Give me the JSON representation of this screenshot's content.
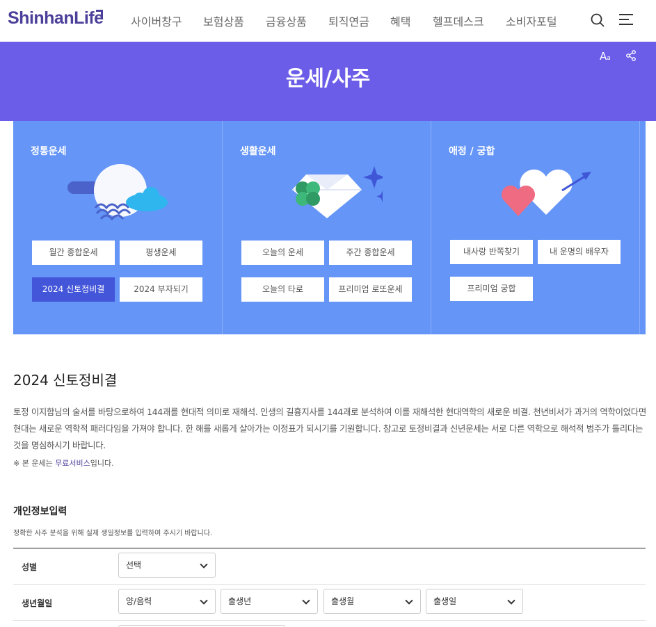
{
  "header": {
    "logo": "ShinhanLife",
    "nav": [
      "사이버창구",
      "보험상품",
      "금융상품",
      "퇴직연금",
      "혜택",
      "헬프데스크",
      "소비자포털"
    ]
  },
  "banner": {
    "title": "운세/사주",
    "font_size_label": "A",
    "font_size_small": "a"
  },
  "categories": [
    {
      "title": "정통운세",
      "items": [
        "월간 종합운세",
        "평생운세",
        "2024 신토정비결",
        "2024 부자되기"
      ]
    },
    {
      "title": "생활운세",
      "items": [
        "오늘의 운세",
        "주간 종합운세",
        "오늘의 타로",
        "프리미엄 로또운세"
      ]
    },
    {
      "title": "애정 / 궁합",
      "items": [
        "내사랑 반쪽찾기",
        "내 운명의 배우자",
        "프리미엄 궁합"
      ]
    }
  ],
  "active_item": "2024 신토정비결",
  "content": {
    "heading": "2024 신토정비결",
    "description": "토정 이지함님의 술서를 바탕으로하여 144괘를 현대적 의미로 재해석. 인생의 길흉지사를 144괘로 분석하여 이를 재해석한 현대역학의 새로운 비결. 천년비서가 과거의 역학이었다면 현대는 새로운 역학적 패러다임을 가져야 합니다. 한 해를 새롭게 살아가는 이정표가 되시기를 기원합니다. 참고로 토정비결과 신년운세는 서로 다른 역학으로 해석적 범주가 틀리다는 것을 명심하시기 바랍니다.",
    "note_prefix": "※ 본 운세는 ",
    "note_link": "무료서비스",
    "note_suffix": "입니다."
  },
  "form": {
    "title": "개인정보입력",
    "description": "정확한 사주 분석을 위해 실제 생일정보를 입력하여 주시기 바랍니다.",
    "gender_label": "성별",
    "gender_value": "선택",
    "birth_label": "생년월일",
    "calendar_value": "양/음력",
    "year_value": "출생년",
    "month_value": "출생월",
    "day_value": "출생일"
  },
  "colors": {
    "brand": "#4b3f9a",
    "banner": "#6b5de8",
    "panel": "#6495f7",
    "active_tile": "#4355d9"
  }
}
